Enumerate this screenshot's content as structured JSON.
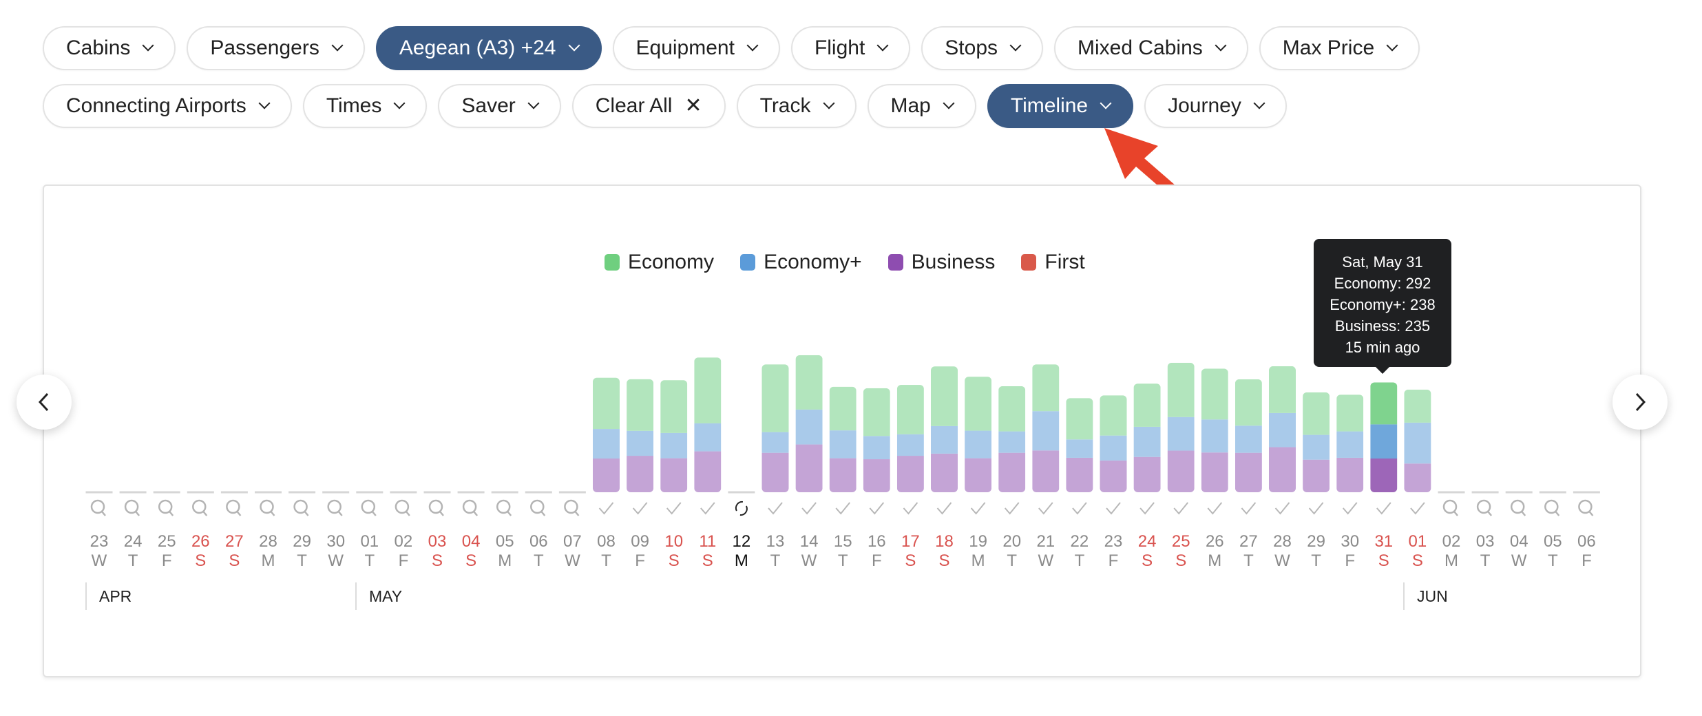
{
  "filters": {
    "row1": [
      {
        "label": "Cabins",
        "active": false,
        "icon": "chevron-down-icon"
      },
      {
        "label": "Passengers",
        "active": false,
        "icon": "chevron-down-icon"
      },
      {
        "label": "Aegean (A3) +24",
        "active": true,
        "icon": "chevron-down-icon"
      },
      {
        "label": "Equipment",
        "active": false,
        "icon": "chevron-down-icon"
      },
      {
        "label": "Flight",
        "active": false,
        "icon": "chevron-down-icon"
      },
      {
        "label": "Stops",
        "active": false,
        "icon": "chevron-down-icon"
      },
      {
        "label": "Mixed Cabins",
        "active": false,
        "icon": "chevron-down-icon"
      },
      {
        "label": "Max Price",
        "active": false,
        "icon": "chevron-down-icon"
      }
    ],
    "row2": [
      {
        "label": "Connecting Airports",
        "active": false,
        "icon": "chevron-down-icon"
      },
      {
        "label": "Times",
        "active": false,
        "icon": "chevron-down-icon"
      },
      {
        "label": "Saver",
        "active": false,
        "icon": "chevron-down-icon"
      },
      {
        "label": "Clear All",
        "active": false,
        "icon": "close-icon"
      },
      {
        "label": "Track",
        "active": false,
        "icon": "chevron-down-icon"
      },
      {
        "label": "Map",
        "active": false,
        "icon": "chevron-down-icon"
      },
      {
        "label": "Timeline",
        "active": true,
        "icon": "chevron-down-icon"
      },
      {
        "label": "Journey",
        "active": false,
        "icon": "chevron-down-icon"
      }
    ]
  },
  "colors": {
    "accent": "#3a5a85",
    "annotation_arrow": "#e8432a",
    "weekend": "#d9534f",
    "economy": "#6fcf7f",
    "economy_plus": "#5b9bd9",
    "business": "#8e4db0",
    "first": "#d9594a"
  },
  "nav": {
    "prev_icon": "chevron-left-icon",
    "next_icon": "chevron-right-icon"
  },
  "tooltip": {
    "title": "Sat, May 31",
    "economy": "Economy: 292",
    "economy_plus": "Economy+: 238",
    "business": "Business: 235",
    "updated": "15 min ago"
  },
  "months": [
    {
      "label": "APR"
    },
    {
      "label": "MAY"
    },
    {
      "label": "JUN"
    }
  ],
  "chart_data": {
    "type": "bar",
    "stacked": true,
    "title": "",
    "legend": {
      "placement": "top-center",
      "entries": [
        "Economy",
        "Economy+",
        "Business",
        "First"
      ]
    },
    "selected_day": "31",
    "today_marker": "12",
    "days": [
      {
        "day": "23",
        "dow": "W",
        "weekend": false,
        "status": "search"
      },
      {
        "day": "24",
        "dow": "T",
        "weekend": false,
        "status": "search"
      },
      {
        "day": "25",
        "dow": "F",
        "weekend": false,
        "status": "search"
      },
      {
        "day": "26",
        "dow": "S",
        "weekend": true,
        "status": "search"
      },
      {
        "day": "27",
        "dow": "S",
        "weekend": true,
        "status": "search"
      },
      {
        "day": "28",
        "dow": "M",
        "weekend": false,
        "status": "search"
      },
      {
        "day": "29",
        "dow": "T",
        "weekend": false,
        "status": "search"
      },
      {
        "day": "30",
        "dow": "W",
        "weekend": false,
        "status": "search"
      },
      {
        "day": "01",
        "dow": "T",
        "weekend": false,
        "status": "search"
      },
      {
        "day": "02",
        "dow": "F",
        "weekend": false,
        "status": "search"
      },
      {
        "day": "03",
        "dow": "S",
        "weekend": true,
        "status": "search"
      },
      {
        "day": "04",
        "dow": "S",
        "weekend": true,
        "status": "search"
      },
      {
        "day": "05",
        "dow": "M",
        "weekend": false,
        "status": "search"
      },
      {
        "day": "06",
        "dow": "T",
        "weekend": false,
        "status": "search"
      },
      {
        "day": "07",
        "dow": "W",
        "weekend": false,
        "status": "search"
      },
      {
        "day": "08",
        "dow": "T",
        "weekend": false,
        "status": "done"
      },
      {
        "day": "09",
        "dow": "F",
        "weekend": false,
        "status": "done"
      },
      {
        "day": "10",
        "dow": "S",
        "weekend": true,
        "status": "done"
      },
      {
        "day": "11",
        "dow": "S",
        "weekend": true,
        "status": "done"
      },
      {
        "day": "12",
        "dow": "M",
        "weekend": false,
        "status": "refreshing"
      },
      {
        "day": "13",
        "dow": "T",
        "weekend": false,
        "status": "done"
      },
      {
        "day": "14",
        "dow": "W",
        "weekend": false,
        "status": "done"
      },
      {
        "day": "15",
        "dow": "T",
        "weekend": false,
        "status": "done"
      },
      {
        "day": "16",
        "dow": "F",
        "weekend": false,
        "status": "done"
      },
      {
        "day": "17",
        "dow": "S",
        "weekend": true,
        "status": "done"
      },
      {
        "day": "18",
        "dow": "S",
        "weekend": true,
        "status": "done"
      },
      {
        "day": "19",
        "dow": "M",
        "weekend": false,
        "status": "done"
      },
      {
        "day": "20",
        "dow": "T",
        "weekend": false,
        "status": "done"
      },
      {
        "day": "21",
        "dow": "W",
        "weekend": false,
        "status": "done"
      },
      {
        "day": "22",
        "dow": "T",
        "weekend": false,
        "status": "done"
      },
      {
        "day": "23",
        "dow": "F",
        "weekend": false,
        "status": "done"
      },
      {
        "day": "24",
        "dow": "S",
        "weekend": true,
        "status": "done"
      },
      {
        "day": "25",
        "dow": "S",
        "weekend": true,
        "status": "done"
      },
      {
        "day": "26",
        "dow": "M",
        "weekend": false,
        "status": "done"
      },
      {
        "day": "27",
        "dow": "T",
        "weekend": false,
        "status": "done"
      },
      {
        "day": "28",
        "dow": "W",
        "weekend": false,
        "status": "done"
      },
      {
        "day": "29",
        "dow": "T",
        "weekend": false,
        "status": "done"
      },
      {
        "day": "30",
        "dow": "F",
        "weekend": false,
        "status": "done"
      },
      {
        "day": "31",
        "dow": "S",
        "weekend": true,
        "status": "done"
      },
      {
        "day": "01",
        "dow": "S",
        "weekend": true,
        "status": "done"
      },
      {
        "day": "02",
        "dow": "M",
        "weekend": false,
        "status": "search"
      },
      {
        "day": "03",
        "dow": "T",
        "weekend": false,
        "status": "search"
      },
      {
        "day": "04",
        "dow": "W",
        "weekend": false,
        "status": "search"
      },
      {
        "day": "05",
        "dow": "T",
        "weekend": false,
        "status": "search"
      },
      {
        "day": "06",
        "dow": "F",
        "weekend": false,
        "status": "search"
      }
    ],
    "series": [
      {
        "name": "Business",
        "values": [
          null,
          null,
          null,
          null,
          null,
          null,
          null,
          null,
          null,
          null,
          null,
          null,
          null,
          null,
          null,
          235,
          254,
          237,
          285,
          null,
          275,
          333,
          237,
          230,
          254,
          269,
          237,
          275,
          291,
          240,
          221,
          246,
          290,
          277,
          275,
          314,
          227,
          240,
          235,
          200,
          null,
          null,
          null,
          null,
          null
        ]
      },
      {
        "name": "Economy+",
        "values": [
          null,
          null,
          null,
          null,
          null,
          null,
          null,
          null,
          null,
          null,
          null,
          null,
          null,
          null,
          null,
          206,
          174,
          176,
          195,
          null,
          144,
          243,
          194,
          162,
          150,
          192,
          192,
          149,
          274,
          128,
          174,
          210,
          234,
          230,
          189,
          238,
          173,
          184,
          238,
          285,
          null,
          null,
          null,
          null,
          null
        ]
      },
      {
        "name": "Economy",
        "values": [
          null,
          null,
          null,
          null,
          null,
          null,
          null,
          null,
          null,
          null,
          null,
          null,
          null,
          null,
          null,
          357,
          360,
          368,
          459,
          null,
          472,
          379,
          304,
          333,
          344,
          416,
          376,
          315,
          326,
          288,
          280,
          301,
          378,
          354,
          323,
          326,
          296,
          256,
          292,
          230,
          null,
          null,
          null,
          null,
          null
        ]
      },
      {
        "name": "First",
        "values": [
          null,
          null,
          null,
          null,
          null,
          null,
          null,
          null,
          null,
          null,
          null,
          null,
          null,
          null,
          null,
          0,
          0,
          0,
          0,
          null,
          0,
          0,
          0,
          0,
          0,
          0,
          0,
          0,
          0,
          0,
          0,
          0,
          0,
          0,
          0,
          0,
          0,
          0,
          0,
          0,
          null,
          null,
          null,
          null,
          null
        ]
      }
    ]
  }
}
